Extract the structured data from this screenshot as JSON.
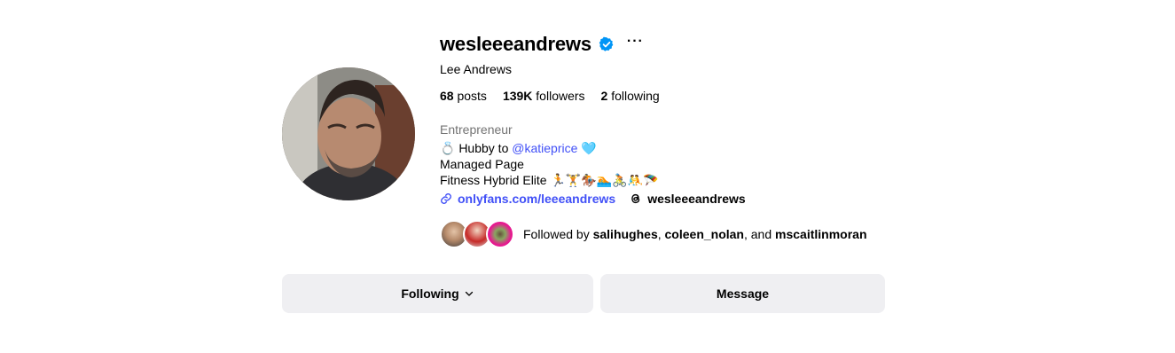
{
  "profile": {
    "username": "wesleeeandrews",
    "verified": true,
    "more_label": "···",
    "full_name": "Lee Andrews",
    "stats": {
      "posts_count": "68",
      "posts_label": "posts",
      "followers_count": "139K",
      "followers_label": "followers",
      "following_count": "2",
      "following_label": "following"
    },
    "category": "Entrepreneur",
    "bio": {
      "line1_prefix": "💍 Hubby to",
      "line1_mention": "@katieprice",
      "line1_suffix": "🩵",
      "line2": "Managed Page",
      "line3": "Fitness Hybrid Elite 🏃🏋️🏇🏊🚴🤼🪂"
    },
    "link_text": "onlyfans.com/leeeandrews",
    "threads_handle": "wesleeeandrews",
    "followed_by": {
      "prefix": "Followed by",
      "user1": "salihughes",
      "sep1": ",",
      "user2": "coleen_nolan",
      "sep2": ", and",
      "user3": "mscaitlinmoran"
    }
  },
  "actions": {
    "following_label": "Following",
    "message_label": "Message"
  },
  "colors": {
    "verified_blue": "#0095f6",
    "link_blue": "#4150f7",
    "button_bg": "#efeff2",
    "secondary_text": "#737373"
  },
  "icons": {
    "verified": "verified-badge-icon",
    "link": "link-icon",
    "threads": "threads-icon",
    "chevron": "chevron-down-icon"
  }
}
